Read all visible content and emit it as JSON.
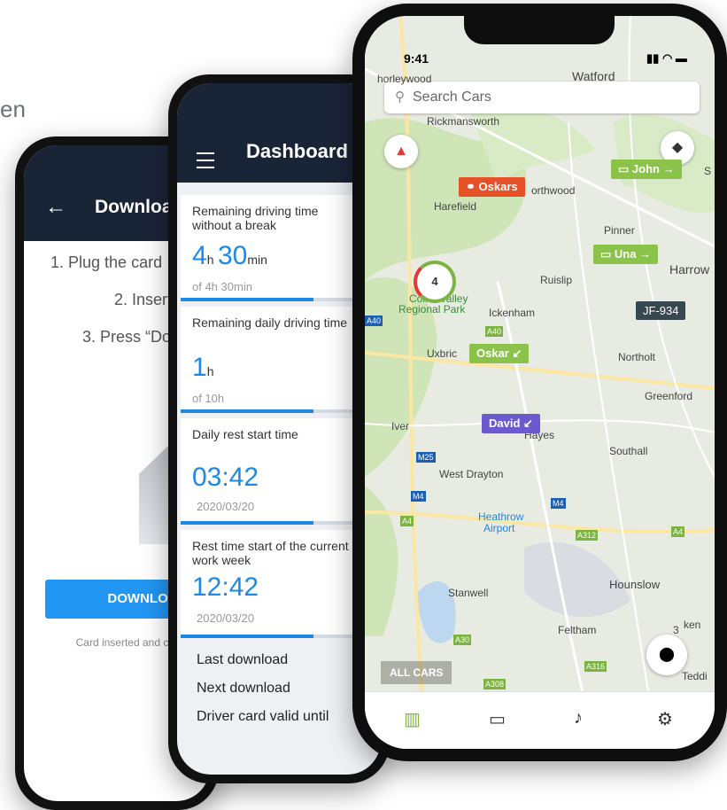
{
  "background_text": "en",
  "download_screen": {
    "back_icon": "arrow-left-icon",
    "title": "Downloa",
    "steps": [
      "1. Plug the card",
      "2. Insert",
      "3. Press “Do"
    ],
    "button_label": "DOWNLOA",
    "note": "Card inserted and co downlo"
  },
  "dashboard": {
    "menu_icon": "hamburger-menu-icon",
    "title": "Dashboard",
    "cards": [
      {
        "label": "Remaining driving time without a break",
        "value_h": "4",
        "unit_h": "h",
        "value_min": "30",
        "unit_min": "min",
        "sub": "of 4h 30min",
        "progress": 0.65
      },
      {
        "label": "Remaining daily driving time",
        "value_h": "1",
        "unit_h": "h",
        "sub": "of 10h",
        "progress": 0.65
      },
      {
        "label": "Daily rest start time",
        "value": "03:42",
        "sub": "2020/03/20",
        "progress": 0.65
      },
      {
        "label": "Rest time start of the current work week",
        "value": "12:42",
        "sub": "2020/03/20",
        "progress": 0.65
      }
    ],
    "rows": [
      "Last download",
      "Next download",
      "Driver card valid until"
    ]
  },
  "map_screen": {
    "status": {
      "time": "9:41",
      "signal": "signal-icon",
      "wifi": "wifi-icon",
      "battery": "battery-icon"
    },
    "search_placeholder": "Search Cars",
    "search_icon": "search-icon",
    "compass_icon": "compass-icon",
    "layers_icon": "layers-icon",
    "location_icon": "location-pin-icon",
    "cluster_count": "4",
    "markers": [
      {
        "label": "Oskars",
        "color": "#e65127",
        "icon": "motorbike-icon"
      },
      {
        "label": "John →",
        "color": "#8bc34a",
        "icon": "car-icon"
      },
      {
        "label": "Una →",
        "color": "#8bc34a",
        "icon": "van-icon"
      },
      {
        "label": "JF-934",
        "color": "#37474f"
      },
      {
        "label": "Oskar ↙",
        "color": "#8bc34a"
      },
      {
        "label": "David ↙",
        "color": "#6a5acd"
      }
    ],
    "places": [
      "Watford",
      "horleywood",
      "Rickmansworth",
      "Harefield",
      "orthwood",
      "Pinner",
      "Harrow",
      "Ruislip",
      "Colne Valley",
      "Regional Park",
      "Ickenham",
      "Uxbric",
      "Northolt",
      "Greenford",
      "Iver",
      "Hayes",
      "Southall",
      "West Drayton",
      "Heathrow",
      "Airport",
      "Stanwell",
      "Hounslow",
      "Feltham",
      "Teddi",
      "ken",
      "S",
      "3"
    ],
    "roads": [
      "A40",
      "A40",
      "M25",
      "M4",
      "M4",
      "A4",
      "A312",
      "A4",
      "A30",
      "A316",
      "A308"
    ],
    "all_cars_label": "ALL CARS",
    "tabs": [
      "map-icon",
      "car-icon",
      "bell-icon",
      "gear-icon"
    ]
  }
}
